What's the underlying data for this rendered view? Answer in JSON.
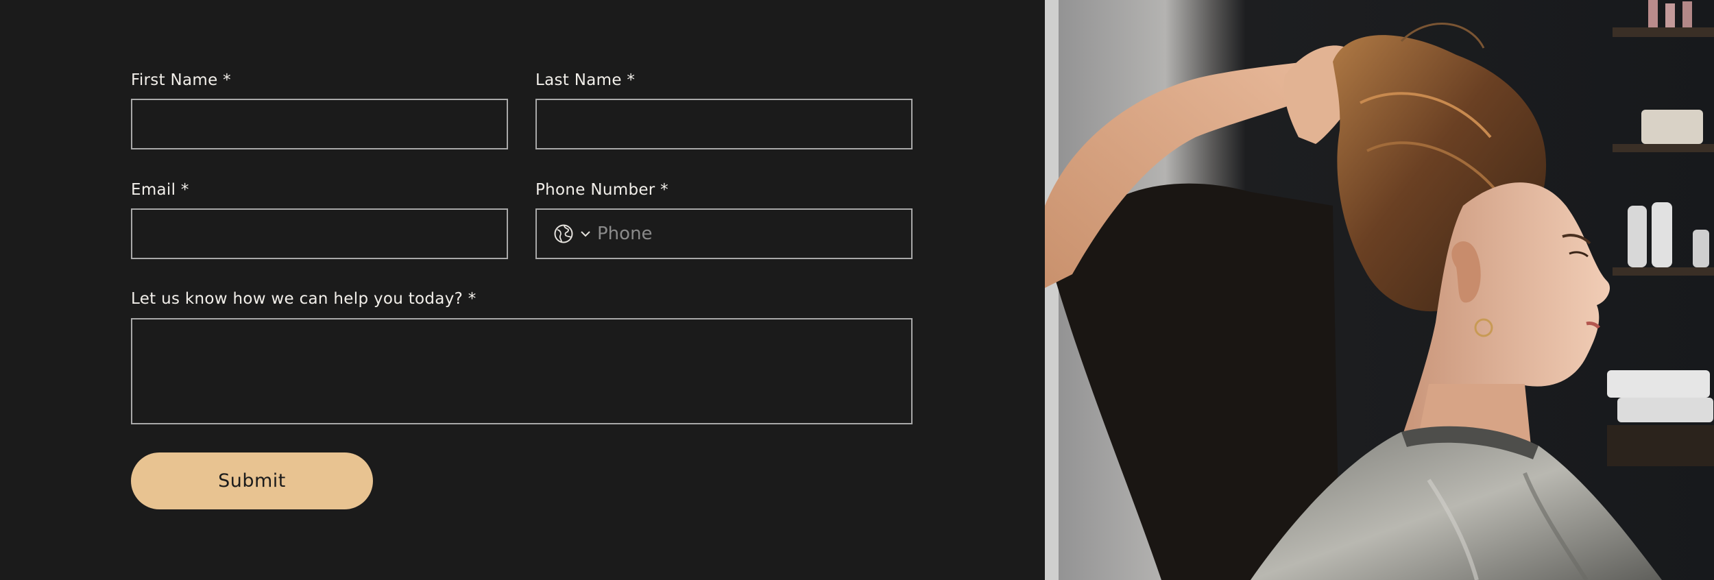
{
  "form": {
    "first_name_label": "First Name *",
    "last_name_label": "Last Name *",
    "email_label": "Email *",
    "phone_label": "Phone Number *",
    "phone_placeholder": "Phone",
    "message_label": "Let us know how we can help you today? *",
    "submit_label": "Submit"
  },
  "photo": {
    "subject": "salon-stylist-photo"
  },
  "colors": {
    "background": "#1b1b1b",
    "accent": "#e8c391",
    "field_border": "#a9a9a9"
  }
}
